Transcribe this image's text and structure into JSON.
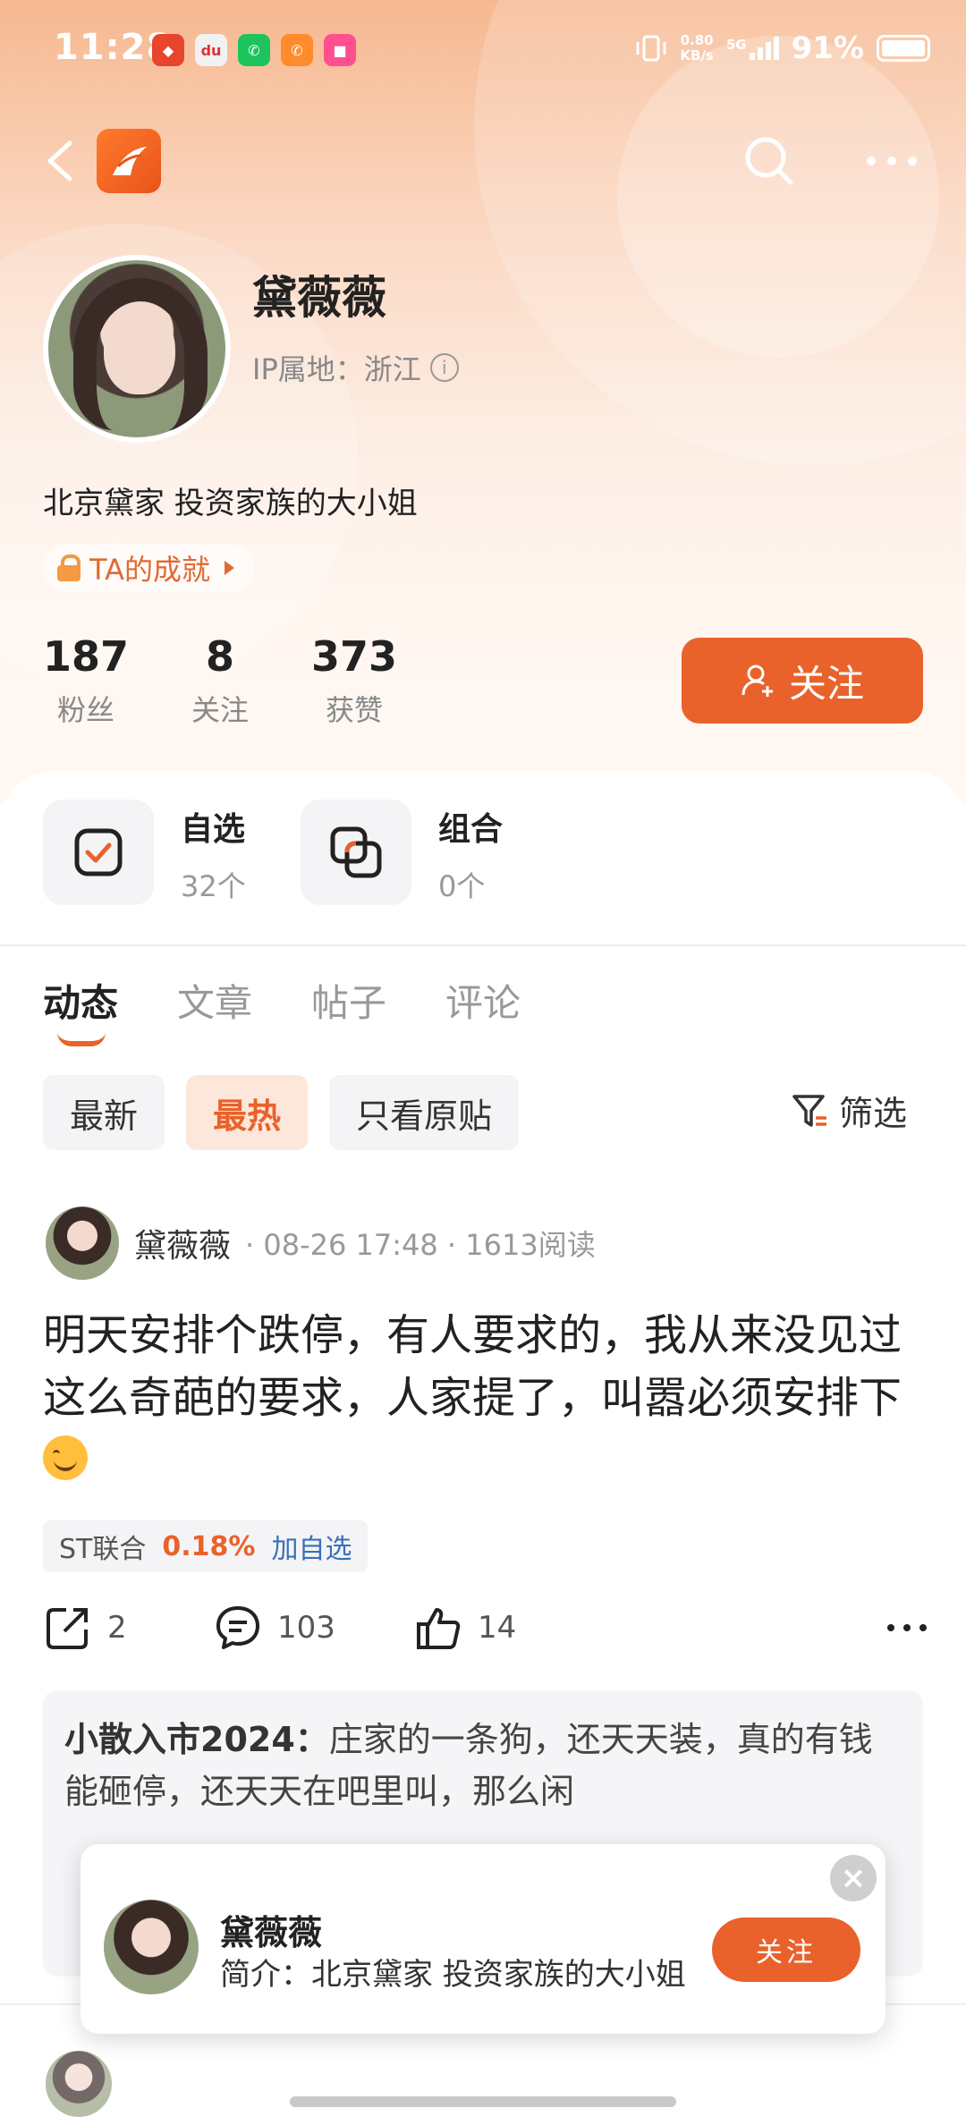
{
  "status_bar": {
    "time": "11:28",
    "net_speed_value": "0.80",
    "net_speed_unit": "KB/s",
    "network": "5G",
    "battery": "91%"
  },
  "profile": {
    "name": "黛薇薇",
    "ip_location": "IP属地：浙江",
    "bio": "北京黛家 投资家族的大小姐",
    "achievement": "TA的成就",
    "stats": [
      {
        "value": "187",
        "label": "粉丝"
      },
      {
        "value": "8",
        "label": "关注"
      },
      {
        "value": "373",
        "label": "获赞"
      }
    ],
    "follow_label": "关注"
  },
  "quick_links": [
    {
      "title": "自选",
      "count": "32个"
    },
    {
      "title": "组合",
      "count": "0个"
    }
  ],
  "tabs": [
    "动态",
    "文章",
    "帖子",
    "评论"
  ],
  "filters": [
    "最新",
    "最热",
    "只看原贴"
  ],
  "filter_button": "筛选",
  "post": {
    "author": "黛薇薇",
    "date": "08-26 17:48",
    "reads": "1613阅读",
    "body": "明天安排个跌停，有人要求的，我从来没见过这么奇葩的要求，人家提了，叫嚣必须安排下",
    "stock": {
      "name": "ST联合",
      "change": "0.18%",
      "add_label": "加自选"
    },
    "shares": "2",
    "comments": "103",
    "likes": "14"
  },
  "comment": {
    "author": "小散入市2024：",
    "text": "庄家的一条狗，还天天装，真的有钱能砸停，还天天在吧里叫，那么闲"
  },
  "popup": {
    "name": "黛薇薇",
    "bio": "简介：北京黛家 投资家族的大小姐",
    "follow_label": "关注"
  },
  "colors": {
    "accent": "#e9622b",
    "link": "#3b6fb6"
  }
}
